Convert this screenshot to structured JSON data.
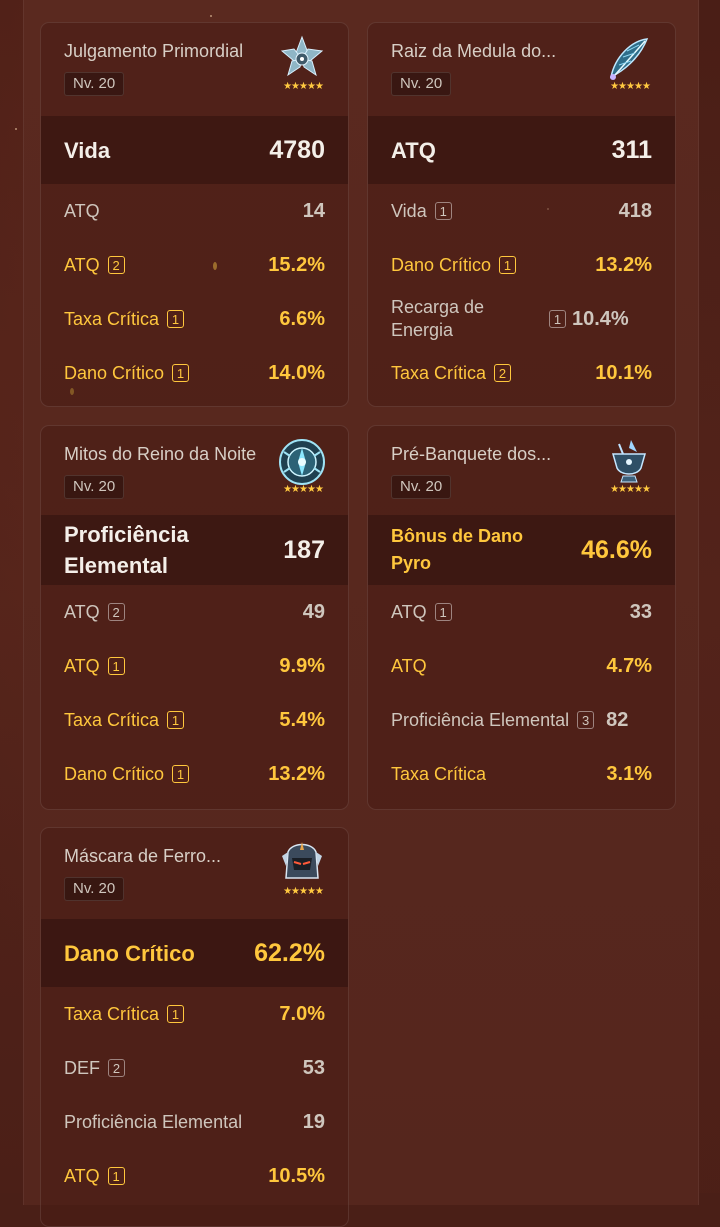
{
  "cards": [
    {
      "name": "Julgamento Primordial",
      "level": "Nv. 20",
      "icon": "flower-artifact-icon",
      "stars": "★★★★★",
      "main": {
        "name": "Vida",
        "value": "4780",
        "highlight": false
      },
      "subs": [
        {
          "name": "ATQ",
          "roll": "",
          "value": "14",
          "highlight": false
        },
        {
          "name": "ATQ",
          "roll": "2",
          "value": "15.2%",
          "highlight": true
        },
        {
          "name": "Taxa Crítica",
          "roll": "1",
          "value": "6.6%",
          "highlight": true
        },
        {
          "name": "Dano Crítico",
          "roll": "1",
          "value": "14.0%",
          "highlight": true
        }
      ]
    },
    {
      "name": "Raiz da Medula do...",
      "level": "Nv. 20",
      "icon": "plume-artifact-icon",
      "stars": "★★★★★",
      "main": {
        "name": "ATQ",
        "value": "311",
        "highlight": false
      },
      "subs": [
        {
          "name": "Vida",
          "roll": "1",
          "value": "418",
          "highlight": false
        },
        {
          "name": "Dano Crítico",
          "roll": "1",
          "value": "13.2%",
          "highlight": true
        },
        {
          "name": "Recarga de Energia",
          "roll": "1",
          "value": "10.4%",
          "highlight": false
        },
        {
          "name": "Taxa Crítica",
          "roll": "2",
          "value": "10.1%",
          "highlight": true
        }
      ]
    },
    {
      "name": "Mitos do Reino da Noite",
      "level": "Nv. 20",
      "icon": "sands-artifact-icon",
      "stars": "★★★★★",
      "main": {
        "name": "Proficiência Elemental",
        "value": "187",
        "highlight": false
      },
      "subs": [
        {
          "name": "ATQ",
          "roll": "2",
          "value": "49",
          "highlight": false
        },
        {
          "name": "ATQ",
          "roll": "1",
          "value": "9.9%",
          "highlight": true
        },
        {
          "name": "Taxa Crítica",
          "roll": "1",
          "value": "5.4%",
          "highlight": true
        },
        {
          "name": "Dano Crítico",
          "roll": "1",
          "value": "13.2%",
          "highlight": true
        }
      ]
    },
    {
      "name": "Pré-Banquete dos...",
      "level": "Nv. 20",
      "icon": "goblet-artifact-icon",
      "stars": "★★★★★",
      "main": {
        "name": "Bônus de Dano Pyro",
        "value": "46.6%",
        "highlight": true
      },
      "subs": [
        {
          "name": "ATQ",
          "roll": "1",
          "value": "33",
          "highlight": false
        },
        {
          "name": "ATQ",
          "roll": "",
          "value": "4.7%",
          "highlight": true
        },
        {
          "name": "Proficiência Elemental",
          "roll": "3",
          "value": "82",
          "highlight": false
        },
        {
          "name": "Taxa Crítica",
          "roll": "",
          "value": "3.1%",
          "highlight": true
        }
      ]
    },
    {
      "name": "Máscara de Ferro...",
      "level": "Nv. 20",
      "icon": "circlet-artifact-icon",
      "stars": "★★★★★",
      "main": {
        "name": "Dano Crítico",
        "value": "62.2%",
        "highlight": true
      },
      "subs": [
        {
          "name": "Taxa Crítica",
          "roll": "1",
          "value": "7.0%",
          "highlight": true
        },
        {
          "name": "DEF",
          "roll": "2",
          "value": "53",
          "highlight": false
        },
        {
          "name": "Proficiência Elemental",
          "roll": "",
          "value": "19",
          "highlight": false
        },
        {
          "name": "ATQ",
          "roll": "1",
          "value": "10.5%",
          "highlight": true
        }
      ]
    }
  ]
}
